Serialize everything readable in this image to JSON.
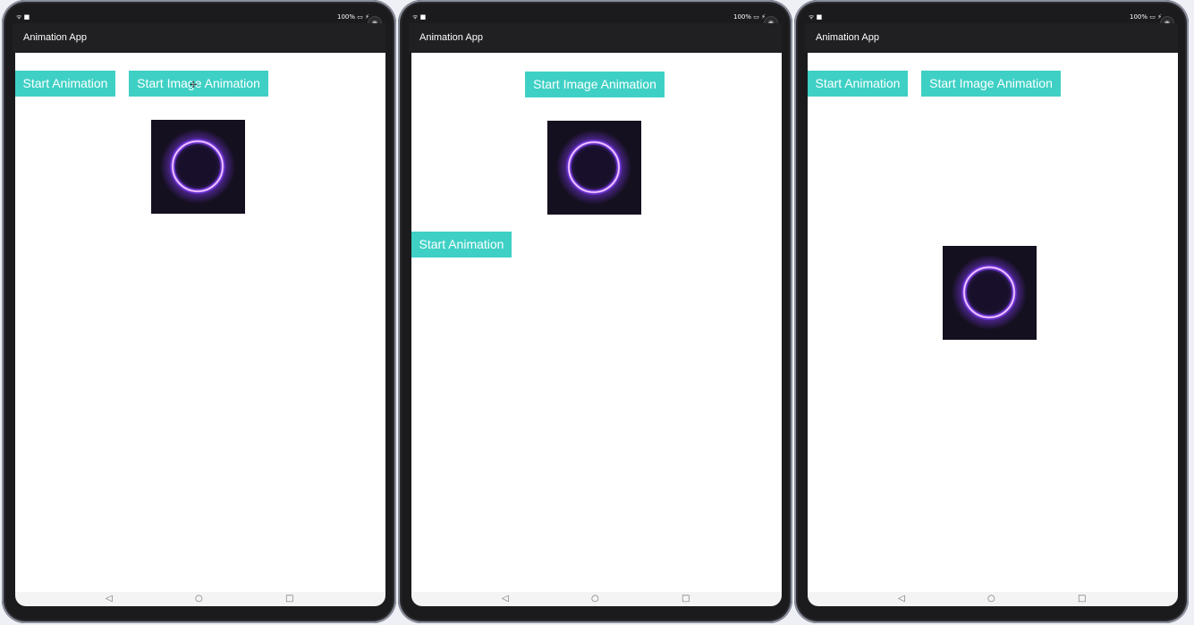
{
  "app": {
    "title": "Animation App"
  },
  "status_bar": {
    "left": "ᯤ ■",
    "right": "100% ▭ ⚡"
  },
  "buttons": {
    "start_animation": "Start Animation",
    "start_image_animation": "Start Image Animation"
  },
  "navigation": {
    "back": "◁",
    "home": "○",
    "recents": "□"
  },
  "icons": {
    "image": "glowing-purple-ring-image",
    "camera": "front-camera-icon"
  },
  "colors": {
    "button_bg": "#3fd0c5",
    "app_bar": "#202022",
    "ring": "#b45cff"
  }
}
